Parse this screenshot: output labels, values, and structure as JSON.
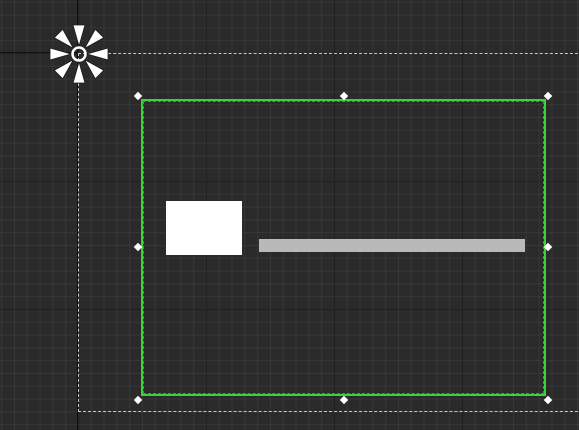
{
  "scene": {
    "background_color": "#2a2a2a",
    "selection_color": "#38d438",
    "handle_color": "#ffffff",
    "element_color": "#ffffff",
    "label_placeholder_color": "#b9b9b9"
  },
  "icons": {
    "pivot": "rect-transform-pivot-icon",
    "handle": "resize-handle-icon"
  }
}
